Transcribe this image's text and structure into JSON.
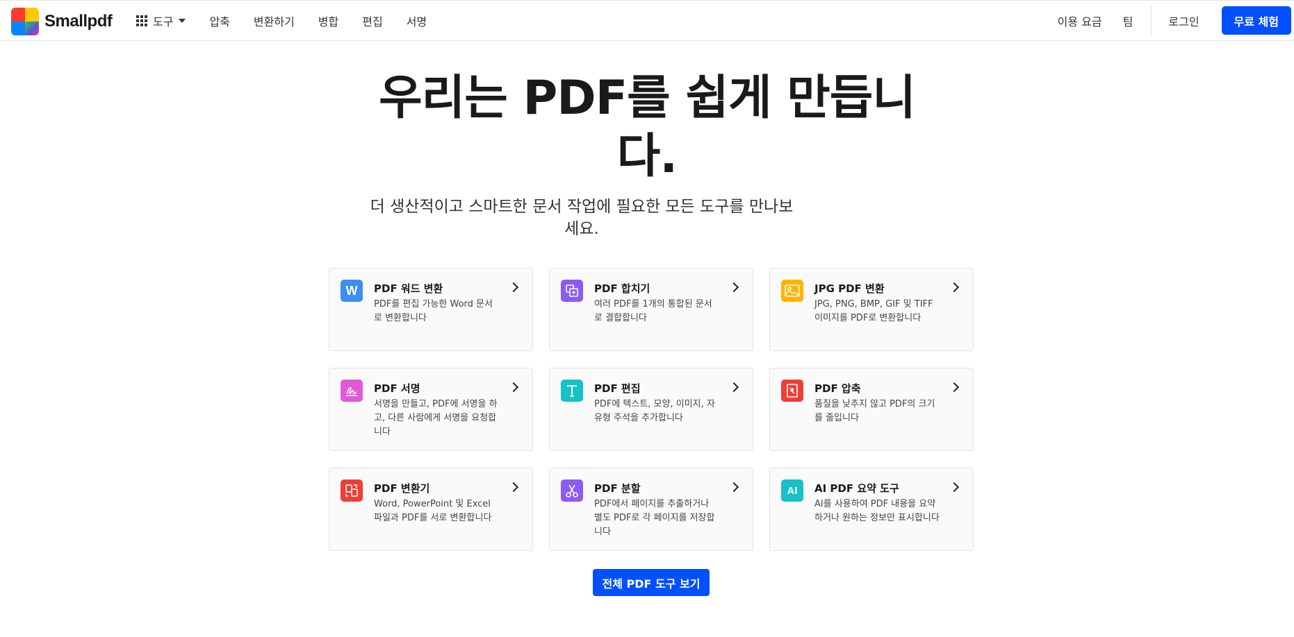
{
  "brand": {
    "name": "Smallpdf",
    "logo_colors": [
      "#ff3b30",
      "#ffc800",
      "#0a84ff",
      "#34c759",
      "#5856d6",
      "#ff2d95"
    ]
  },
  "nav": {
    "tools_label": "도구",
    "links": [
      "압축",
      "변환하기",
      "병합",
      "편집",
      "서명"
    ]
  },
  "right_nav": {
    "pricing": "이용 요금",
    "team": "팀",
    "login": "로그인",
    "trial": "무료 체험"
  },
  "hero": {
    "title": "우리는 PDF를 쉽게 만듭니다.",
    "subtitle": "더 생산적이고 스마트한 문서 작업에 필요한 모든 도구를 만나보세요."
  },
  "tools": [
    {
      "title": "PDF 워드 변환",
      "desc": "PDF를 편집 가능한 Word 문서로 변환합니다",
      "icon": "word-icon",
      "color": "#3f8cf2"
    },
    {
      "title": "PDF 합치기",
      "desc": "여러 PDF를 1개의 통합된 문서로 결합합니다",
      "icon": "merge-icon",
      "color": "#8a5cf5"
    },
    {
      "title": "JPG PDF 변환",
      "desc": "JPG, PNG, BMP, GIF 및 TIFF 이미지를 PDF로 변환합니다",
      "icon": "image-icon",
      "color": "#ffb300"
    },
    {
      "title": "PDF 서명",
      "desc": "서명을 만들고, PDF에 서명을 하고, 다른 사람에게 서명을 요청합니다",
      "icon": "signature-icon",
      "color": "#e05ad8"
    },
    {
      "title": "PDF 편집",
      "desc": "PDF에 텍스트, 모양, 이미지, 자유형 주석을 추가합니다",
      "icon": "text-edit-icon",
      "color": "#16c1c8"
    },
    {
      "title": "PDF 압축",
      "desc": "품질을 낮추지 않고 PDF의 크기를 줄입니다",
      "icon": "compress-icon",
      "color": "#ef3e36"
    },
    {
      "title": "PDF 변환기",
      "desc": "Word, PowerPoint 및 Excel 파일과 PDF를 서로 변환합니다",
      "icon": "convert-icon",
      "color": "#ef3e36"
    },
    {
      "title": "PDF 분할",
      "desc": "PDF에서 페이지를 추출하거나 별도 PDF로 각 페이지를 저장합니다",
      "icon": "scissors-icon",
      "color": "#8a5cf5"
    },
    {
      "title": "AI PDF 요약 도구",
      "desc": "AI를 사용하여 PDF 내용을 요약하거나 원하는 정보만 표시합니다",
      "icon": "ai-icon",
      "color": "#16c1c8",
      "icon_text": "AI"
    }
  ],
  "cta": {
    "all_tools": "전체 PDF 도구 보기"
  }
}
